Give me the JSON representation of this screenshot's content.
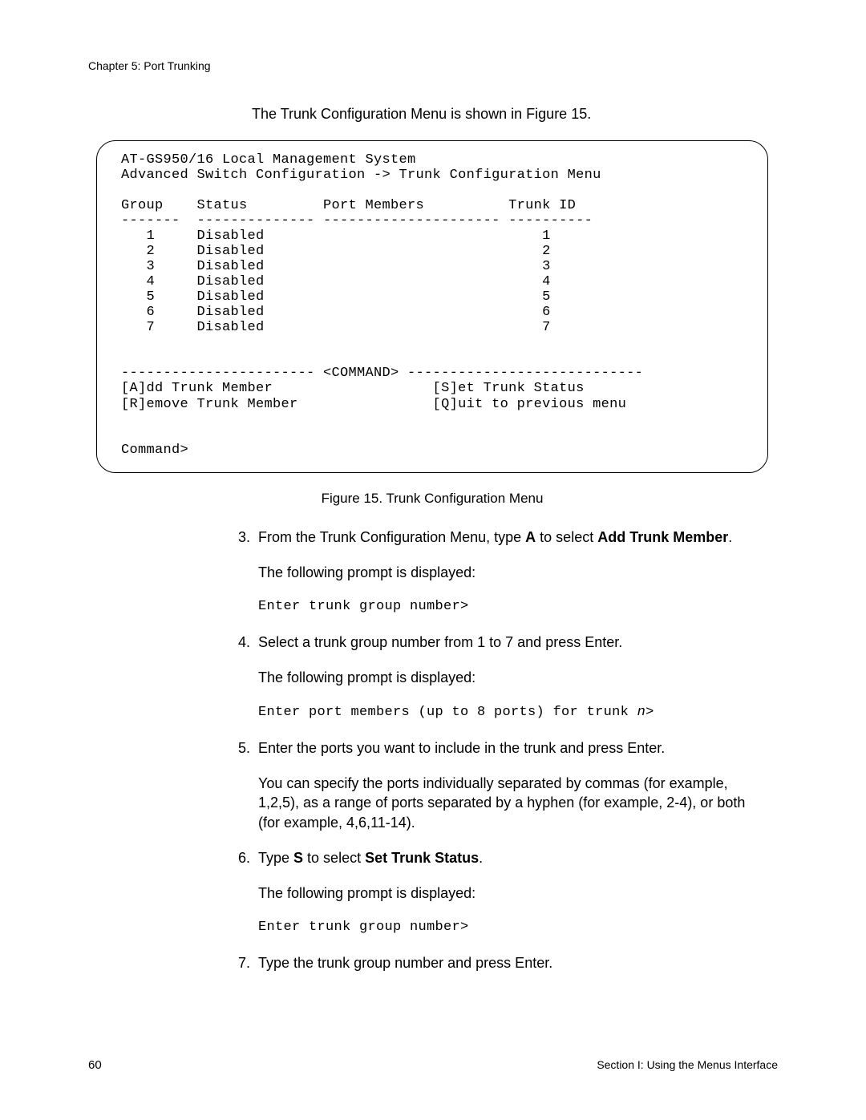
{
  "header": {
    "chapter": "Chapter 5: Port Trunking"
  },
  "intro": "The Trunk Configuration Menu is shown in Figure 15.",
  "terminal": {
    "line01": "AT-GS950/16 Local Management System",
    "line02": "Advanced Switch Configuration -> Trunk Configuration Menu",
    "head_group": "Group",
    "head_status": "Status",
    "head_members": "Port Members",
    "head_trunk": "Trunk ID",
    "rule1": "-------  -------------- --------------------- ----------",
    "rows": [
      {
        "grp": "1",
        "status": "Disabled",
        "members": "",
        "trunk": "1"
      },
      {
        "grp": "2",
        "status": "Disabled",
        "members": "",
        "trunk": "2"
      },
      {
        "grp": "3",
        "status": "Disabled",
        "members": "",
        "trunk": "3"
      },
      {
        "grp": "4",
        "status": "Disabled",
        "members": "",
        "trunk": "4"
      },
      {
        "grp": "5",
        "status": "Disabled",
        "members": "",
        "trunk": "5"
      },
      {
        "grp": "6",
        "status": "Disabled",
        "members": "",
        "trunk": "6"
      },
      {
        "grp": "7",
        "status": "Disabled",
        "members": "",
        "trunk": "7"
      }
    ],
    "cmdrule": "----------------------- <COMMAND> ----------------------------",
    "cmdA": "[A]dd Trunk Member",
    "cmdS": "[S]et Trunk Status",
    "cmdR": "[R]emove Trunk Member",
    "cmdQ": "[Q]uit to previous menu",
    "prompt": "Command>"
  },
  "figure_caption": "Figure 15. Trunk Configuration Menu",
  "steps": {
    "s3": {
      "num": "3.",
      "t1a": "From the Trunk Configuration Menu, type ",
      "t1b": "A",
      "t1c": " to select ",
      "t1d": "Add Trunk Member",
      "t1e": ".",
      "t2": "The following prompt is displayed:",
      "t3": "Enter trunk group number>"
    },
    "s4": {
      "num": "4.",
      "t1": "Select a trunk group number from 1 to 7 and press Enter.",
      "t2": "The following prompt is displayed:",
      "t3a": "Enter port members (up to 8 ports) for trunk ",
      "t3b": "n",
      "t3c": ">"
    },
    "s5": {
      "num": "5.",
      "t1": "Enter the ports you want to include in the trunk and press Enter.",
      "t2": "You can specify the ports individually separated by commas (for example, 1,2,5), as a range of ports separated by a hyphen (for example, 2-4), or both (for example, 4,6,11-14)."
    },
    "s6": {
      "num": "6.",
      "t1a": "Type ",
      "t1b": "S",
      "t1c": " to select ",
      "t1d": "Set Trunk Status",
      "t1e": ".",
      "t2": "The following prompt is displayed:",
      "t3": "Enter trunk group number>"
    },
    "s7": {
      "num": "7.",
      "t1": "Type the trunk group number and press Enter."
    }
  },
  "footer": {
    "page": "60",
    "section": "Section I: Using the Menus Interface"
  }
}
